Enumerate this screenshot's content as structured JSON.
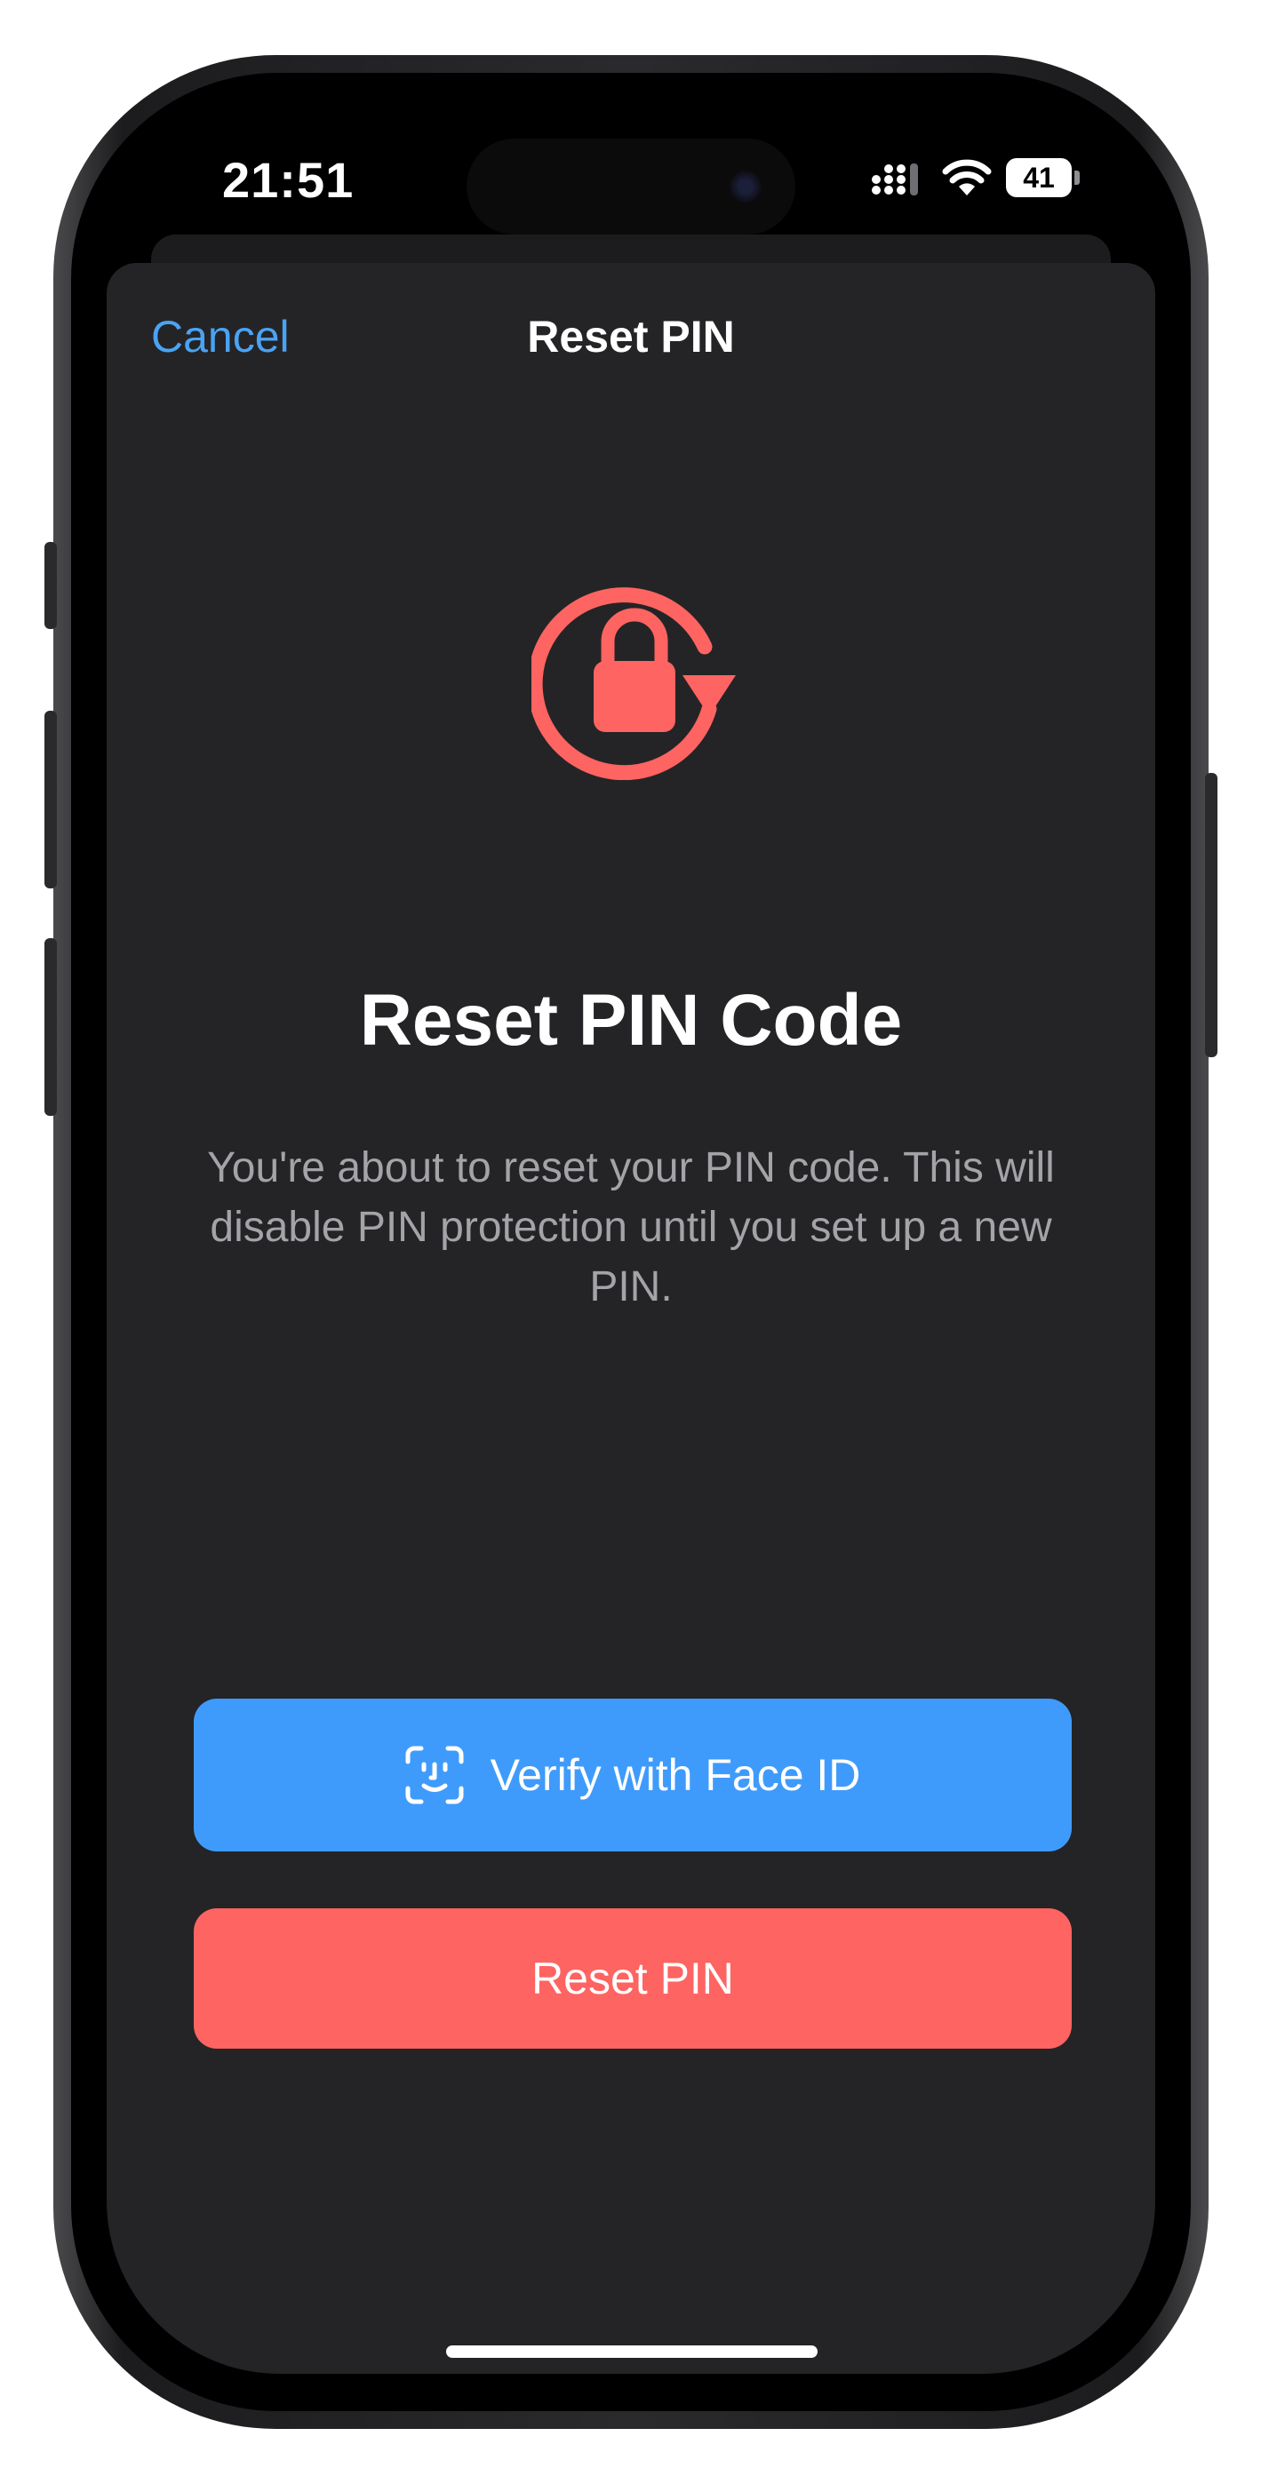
{
  "status_bar": {
    "time": "21:51",
    "battery": "41",
    "icons": [
      "signal-icon",
      "wifi-icon",
      "battery-icon"
    ]
  },
  "nav": {
    "cancel_label": "Cancel",
    "title": "Reset PIN"
  },
  "content": {
    "icon": "lock-reset-icon",
    "heading": "Reset PIN Code",
    "description": "You're about to reset your PIN code. This will disable PIN protection until you set up a new PIN."
  },
  "buttons": {
    "face_id_label": "Verify with Face ID",
    "face_id_icon": "face-id-icon",
    "reset_label": "Reset PIN"
  },
  "colors": {
    "accent_blue": "#3f9bfb",
    "link_blue": "#4aa3f3",
    "danger_red": "#fe6461",
    "sheet_bg": "#242426",
    "secondary_text": "#a3a3a8"
  }
}
